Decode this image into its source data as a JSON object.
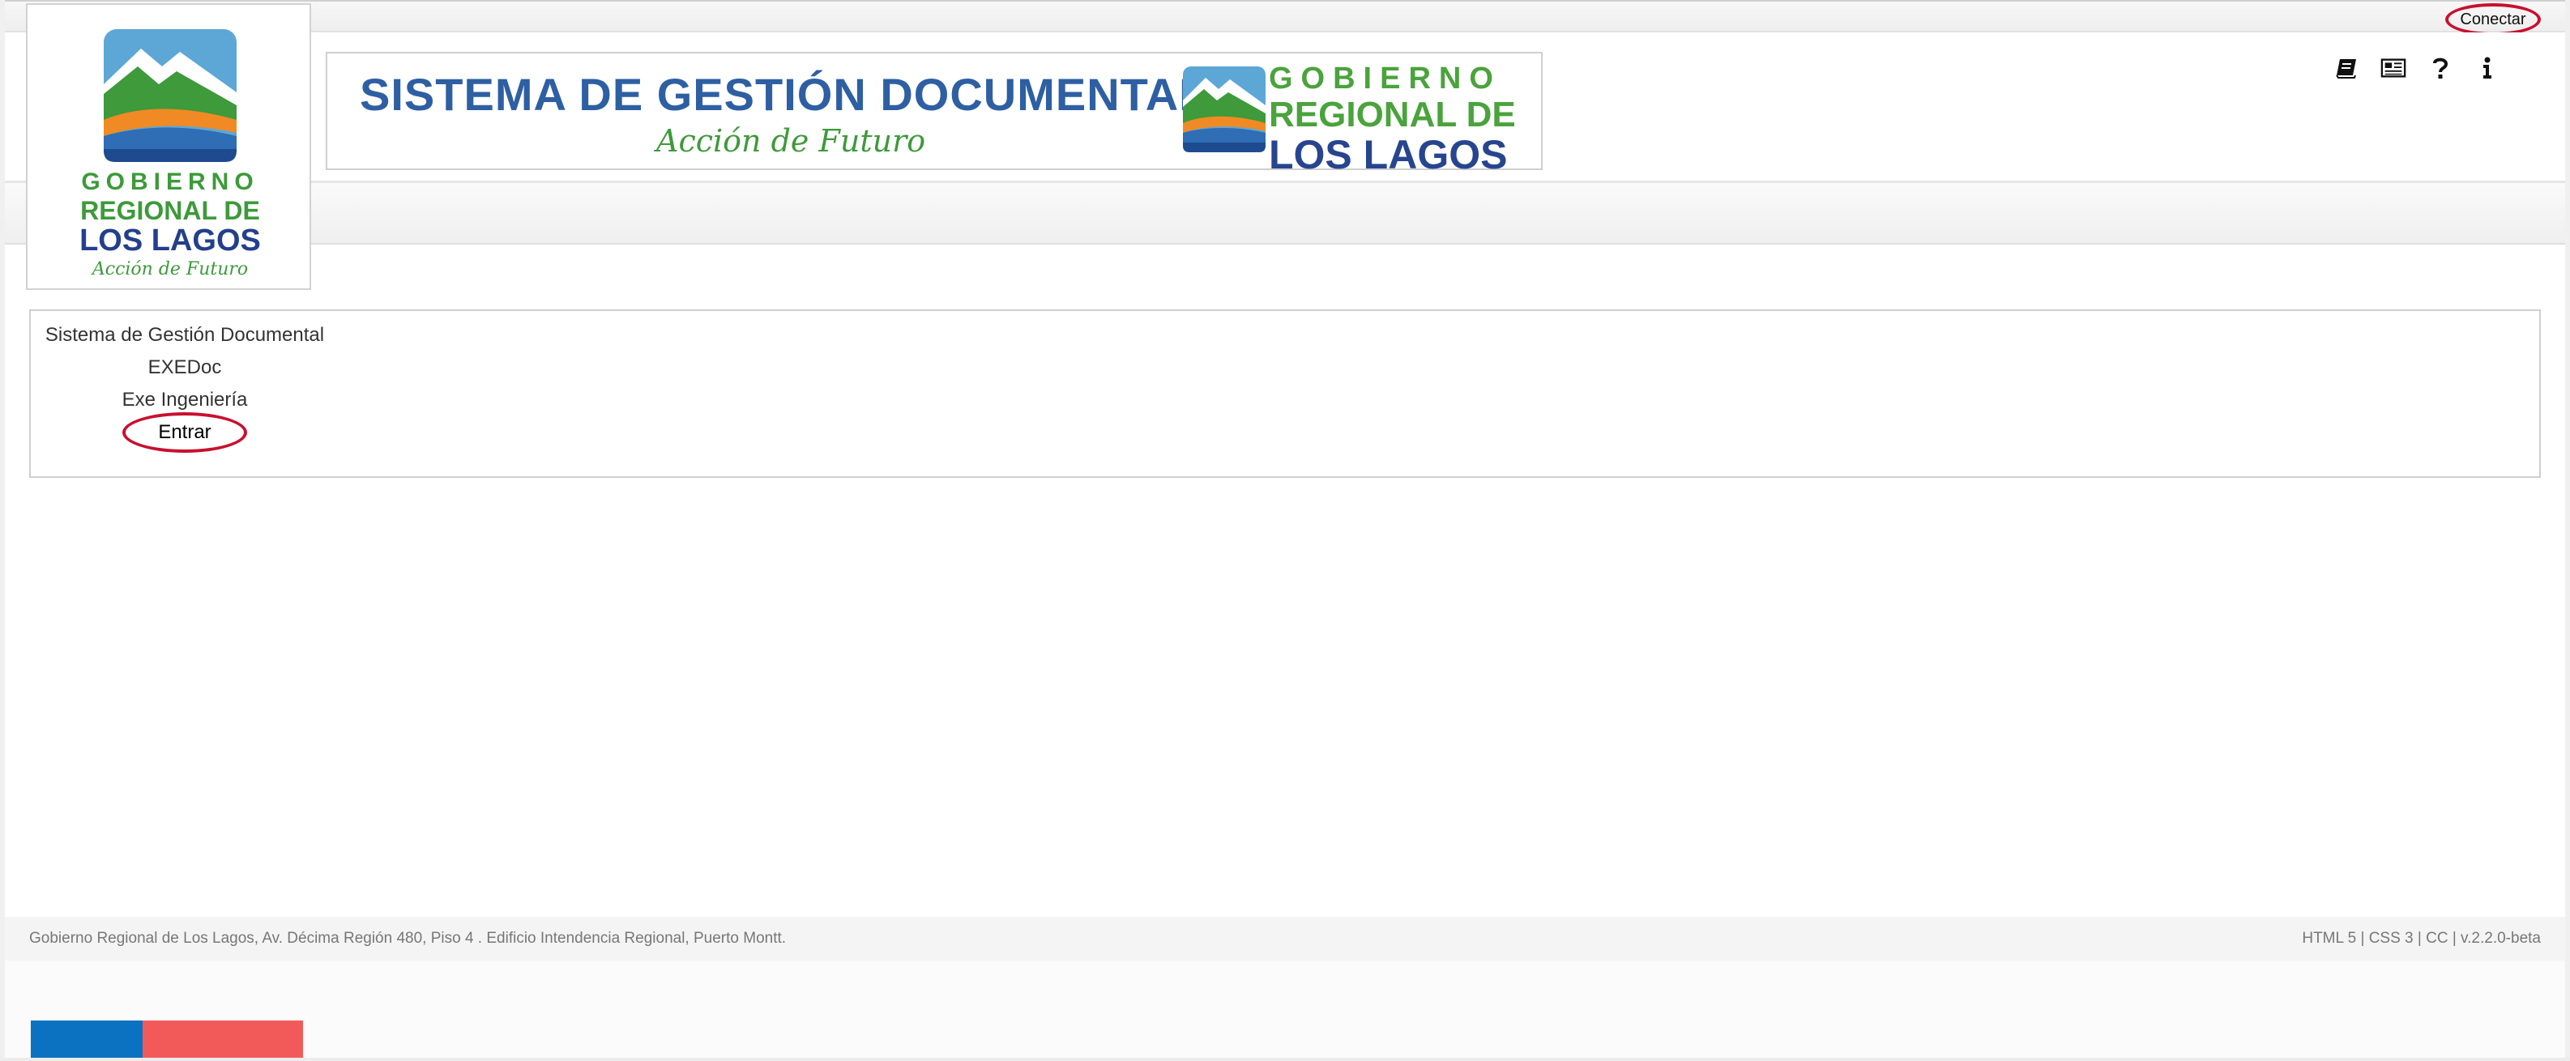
{
  "topbar": {
    "connect_label": "Conectar"
  },
  "header": {
    "icons": [
      "book-icon",
      "newspaper-icon",
      "question-icon",
      "info-icon"
    ]
  },
  "logo": {
    "line1": "GOBIERNO",
    "line2": "REGIONAL DE",
    "line3": "LOS LAGOS",
    "tagline": "Acción de Futuro"
  },
  "banner": {
    "title": "SISTEMA DE GESTIÓN DOCUMENTAL",
    "tagline": "Acción de Futuro",
    "gob_line1": "GOBIERNO",
    "gob_line2": "REGIONAL DE",
    "gob_line3": "LOS LAGOS"
  },
  "main": {
    "system_name": "Sistema de Gestión Documental",
    "product": "EXEDoc",
    "company": "Exe Ingeniería",
    "enter_label": "Entrar"
  },
  "footer": {
    "address": "Gobierno Regional de Los Lagos, Av. Décima Región 480, Piso 4 . Edificio Intendencia Regional, Puerto Montt.",
    "tech": "HTML 5 | CSS 3 | CC | v.2.2.0-beta"
  },
  "colors": {
    "accent_red": "#c8102e",
    "title_blue": "#2e5fa3",
    "brand_green": "#3d9a3a",
    "brand_navy": "#243f8c",
    "flag_blue": "#0a72c0",
    "flag_red": "#f25a5a"
  }
}
